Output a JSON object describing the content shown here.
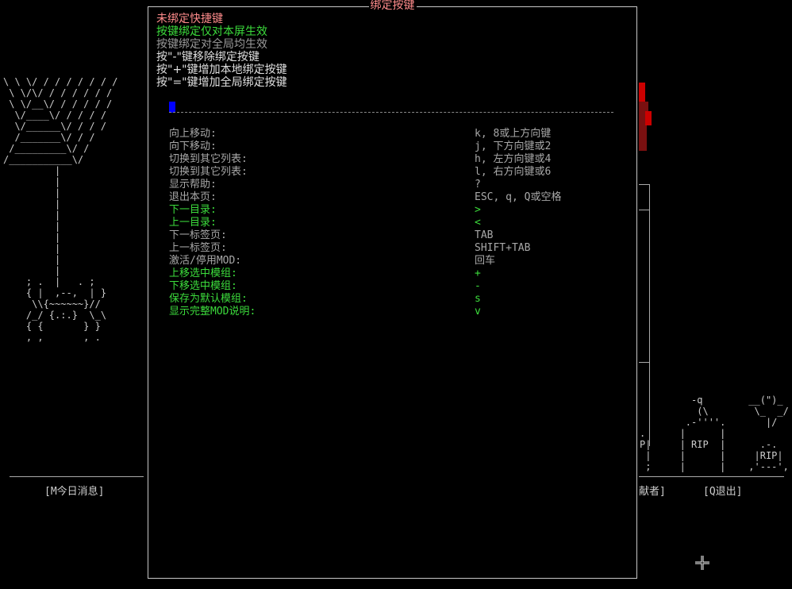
{
  "dialog": {
    "title": "绑定按键",
    "info": [
      {
        "text": "未绑定快捷键",
        "color": "#ff8c8c"
      },
      {
        "text": "按键绑定仅对本屏生效",
        "color": "#3cdc3c"
      },
      {
        "text": "按键绑定对全局均生效",
        "color": "#9a9a9a"
      },
      {
        "text": "按\"-\"键移除绑定按键",
        "color": "#e0e0e0"
      },
      {
        "text": "按\"+\"键增加本地绑定按键",
        "color": "#e0e0e0"
      },
      {
        "text": "按\"=\"键增加全局绑定按键",
        "color": "#e0e0e0"
      }
    ],
    "bindings": [
      {
        "action": "向上移动:",
        "key": "k, 8或上方向键",
        "color": "gray"
      },
      {
        "action": "向下移动:",
        "key": "j, 下方向键或2",
        "color": "gray"
      },
      {
        "action": "切换到其它列表:",
        "key": "h, 左方向键或4",
        "color": "gray"
      },
      {
        "action": "切换到其它列表:",
        "key": "l, 右方向键或6",
        "color": "gray"
      },
      {
        "action": "显示帮助:",
        "key": "?",
        "color": "gray"
      },
      {
        "action": "退出本页:",
        "key": "ESC, q, Q或空格",
        "color": "gray"
      },
      {
        "action": "下一目录:",
        "key": ">",
        "color": "green"
      },
      {
        "action": "上一目录:",
        "key": "<",
        "color": "green"
      },
      {
        "action": "下一标签页:",
        "key": "TAB",
        "color": "gray"
      },
      {
        "action": "上一标签页:",
        "key": "SHIFT+TAB",
        "color": "gray"
      },
      {
        "action": "激活/停用MOD:",
        "key": "回车",
        "color": "gray"
      },
      {
        "action": "上移选中模组:",
        "key": "+",
        "color": "green"
      },
      {
        "action": "下移选中模组:",
        "key": "-",
        "color": "green"
      },
      {
        "action": "保存为默认模组:",
        "key": "s",
        "color": "green"
      },
      {
        "action": "显示完整MOD说明:",
        "key": "v",
        "color": "green"
      }
    ]
  },
  "background": {
    "left_art": "\\ \\ \\/ / / / / / / /\n \\ \\/\\/ / / / / / /\n \\ \\/__\\/ / / / / /\n  \\/____\\/ / / / /\n  \\/______\\/ / / /\n  /_______\\/ / /\n /_________\\/ /\n/___________\\/\n         |\n         |\n         |\n         |\n         |\n         |\n         |\n         |\n         |\n         |\n    ; .  |   . ;\n    { |  ,--,  | }\n     \\\\{~~~~~~}//\n    /_/ {.:.}  \\_\\\n    { {       } }\n    , ,       , .",
    "right_art": "         -q        __(\")_\n          (\\        \\_  _/\n        .-''''.       |/\n.      |      |\nP|     | RIP  |      .-.\n |     |      |     |RIP|\n ;     |      |    ,'---',",
    "motd_label": "[M今日消息]",
    "contrib_label": "献者]",
    "quit_label": "[Q退出]"
  }
}
